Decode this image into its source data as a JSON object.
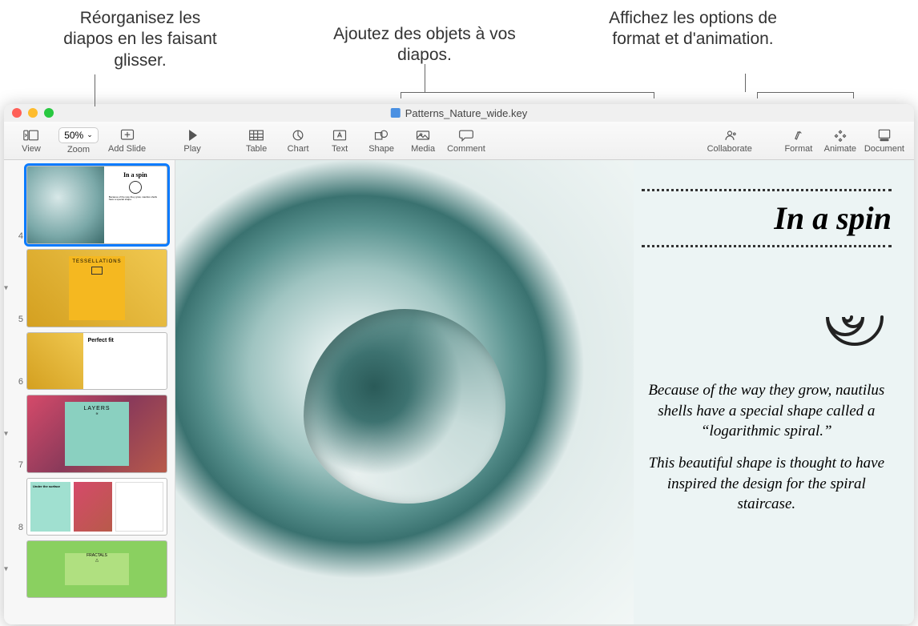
{
  "annotations": {
    "reorder": "Réorganisez les diapos en les faisant glisser.",
    "addobjects": "Ajoutez des objets à vos diapos.",
    "formatopts": "Affichez les options de format et d'animation."
  },
  "window": {
    "filename": "Patterns_Nature_wide.key"
  },
  "toolbar": {
    "view": "View",
    "zoom_value": "50%",
    "zoom_label": "Zoom",
    "add_slide": "Add Slide",
    "play": "Play",
    "table": "Table",
    "chart": "Chart",
    "text": "Text",
    "shape": "Shape",
    "media": "Media",
    "comment": "Comment",
    "collaborate": "Collaborate",
    "format": "Format",
    "animate": "Animate",
    "document": "Document"
  },
  "thumbnails": [
    {
      "num": "4",
      "type": "spin",
      "title": "In a spin"
    },
    {
      "num": "5",
      "type": "tess",
      "title": "TESSELLATIONS"
    },
    {
      "num": "6",
      "type": "fit",
      "title": "Perfect fit"
    },
    {
      "num": "7",
      "type": "lay",
      "title": "LAYERS"
    },
    {
      "num": "8",
      "type": "und",
      "title": "Under the surface"
    },
    {
      "num": "",
      "type": "frac",
      "title": "FRACTALS"
    }
  ],
  "slide": {
    "title": "In a spin",
    "para1": "Because of the way they grow, nautilus shells have a special shape called a “logarithmic spiral.”",
    "para2": "This beautiful shape is thought to have inspired the design for the spiral staircase."
  }
}
